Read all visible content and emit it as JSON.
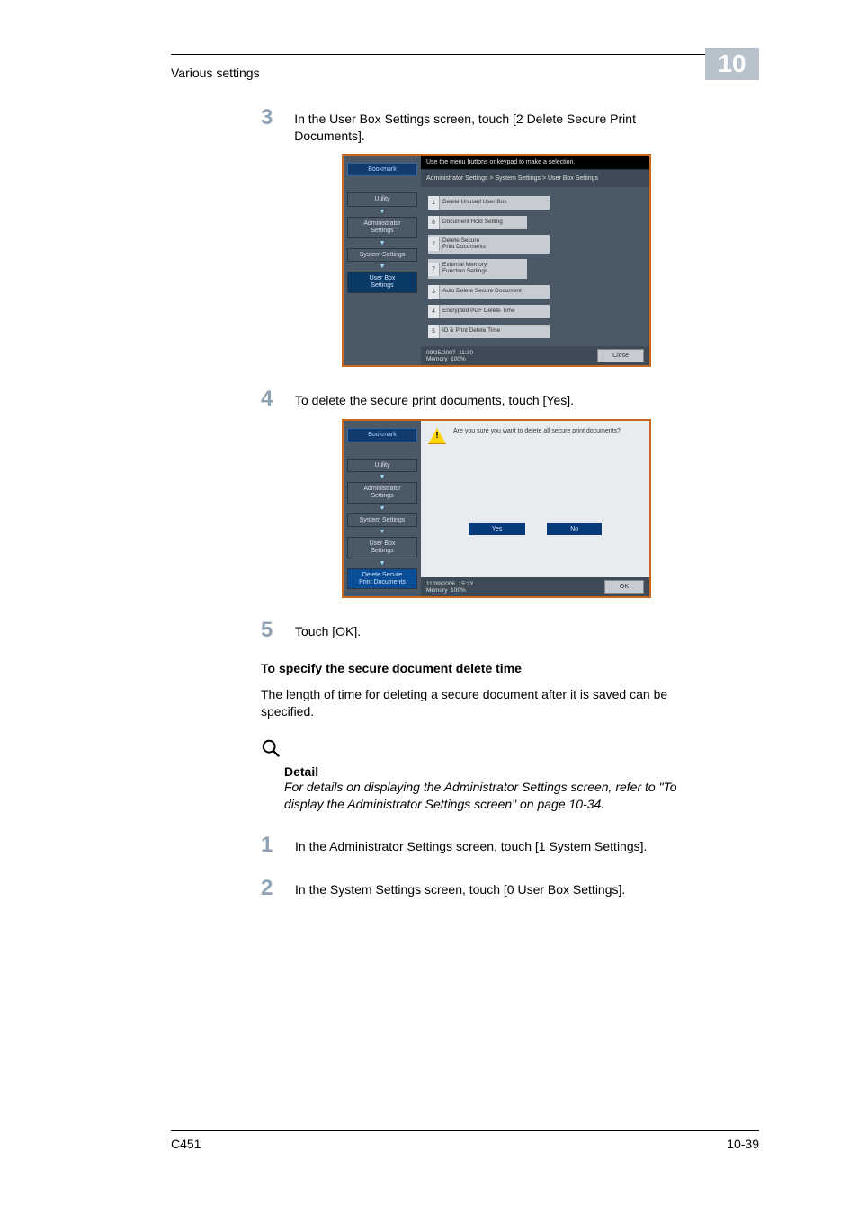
{
  "header": {
    "title": "Various settings",
    "chapter": "10"
  },
  "footer": {
    "model": "C451",
    "page": "10-39"
  },
  "steps": {
    "s3": {
      "num": "3",
      "text": "In the User Box Settings screen, touch [2 Delete Secure Print Documents]."
    },
    "s4": {
      "num": "4",
      "text": "To delete the secure print documents, touch [Yes]."
    },
    "s5": {
      "num": "5",
      "text": "Touch [OK]."
    },
    "s1b": {
      "num": "1",
      "text": "In the Administrator Settings screen, touch [1 System Settings]."
    },
    "s2b": {
      "num": "2",
      "text": "In the System Settings screen, touch [0 User Box Settings]."
    }
  },
  "subheading": "To specify the secure document delete time",
  "para": "The length of time for deleting a secure document after it is saved can be specified.",
  "detail": {
    "title": "Detail",
    "body": "For details on displaying the Administrator Settings screen, refer to \"To display the Administrator Settings screen\" on page 10-34."
  },
  "shot1": {
    "hint": "Use the menu buttons or keypad to make a selection.",
    "crumb": "Administrator Settings > System Settings > User Box Settings",
    "nav": {
      "bookmark": "Bookmark",
      "items": [
        "Utility",
        "Administrator\nSettings",
        "System Settings",
        "User Box\nSettings"
      ]
    },
    "menu": [
      {
        "n": "1",
        "lbl": "Delete Unused User Box"
      },
      {
        "n": "6",
        "lbl": "Document Hold Setting"
      },
      {
        "n": "2",
        "lbl": "Delete Secure\nPrint Documents"
      },
      {
        "n": "7",
        "lbl": "External Memory\nFunction Settings"
      },
      {
        "n": "3",
        "lbl": "Auto Delete Secure Document"
      },
      {
        "n": "4",
        "lbl": "Encrypted PDF Delete Time"
      },
      {
        "n": "5",
        "lbl": "ID & Print Delete Time"
      }
    ],
    "status": {
      "date": "09/25/2007",
      "time": "11:30",
      "mem": "Memory",
      "pct": "100%",
      "close": "Close"
    }
  },
  "shot2": {
    "msg": "Are you sure you want to delete all secure print documents?",
    "nav": {
      "bookmark": "Bookmark",
      "items": [
        "Utility",
        "Administrator\nSettings",
        "System Settings",
        "User Box\nSettings",
        "Delete Secure\nPrint Documents"
      ]
    },
    "yes": "Yes",
    "no": "No",
    "status": {
      "date": "11/09/2006",
      "time": "15:23",
      "mem": "Memory",
      "pct": "100%",
      "ok": "OK"
    }
  }
}
